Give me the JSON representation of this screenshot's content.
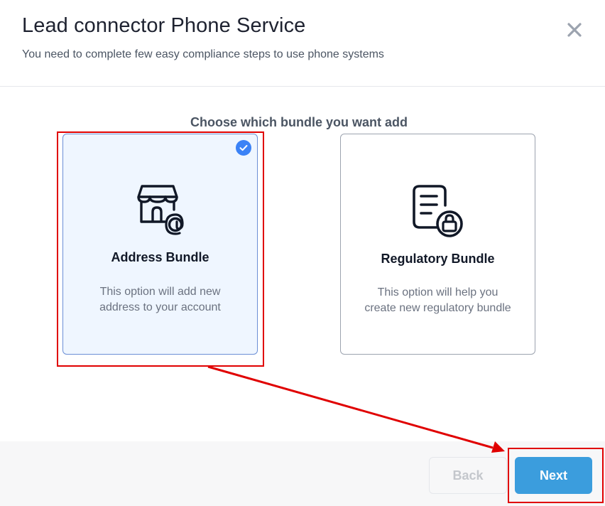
{
  "header": {
    "title": "Lead connector Phone Service",
    "subtitle": "You need to complete few easy compliance steps to use phone systems",
    "close_icon": "close-icon"
  },
  "main": {
    "prompt": "Choose which bundle you want add",
    "cards": [
      {
        "title": "Address Bundle",
        "description": "This option will add new address to your account",
        "icon": "store-address-icon",
        "selected": true
      },
      {
        "title": "Regulatory Bundle",
        "description": "This option will help you create new regulatory bundle",
        "icon": "document-lock-icon",
        "selected": false
      }
    ]
  },
  "footer": {
    "back_label": "Back",
    "back_disabled": true,
    "next_label": "Next"
  },
  "colors": {
    "accent": "#3b82f6",
    "next_button": "#3b9ddd",
    "selected_card_bg": "#eff6ff",
    "annotation": "#e00000"
  }
}
